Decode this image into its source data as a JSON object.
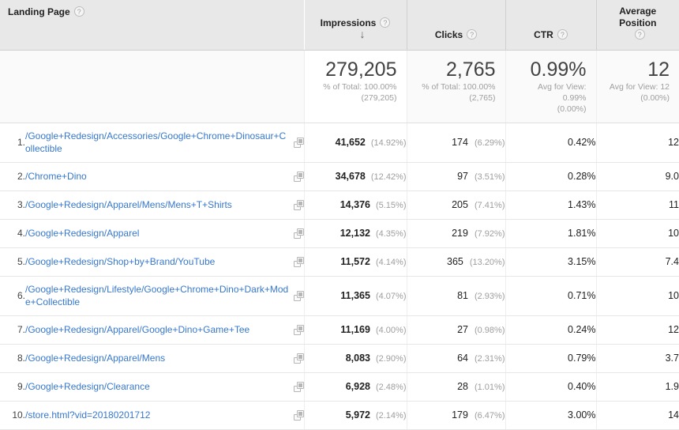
{
  "table": {
    "dimension_header": {
      "label": "Landing Page",
      "help_icon": "help-circle-icon"
    },
    "metric_headers": [
      {
        "label": "Impressions",
        "help_icon": "help-circle-icon",
        "sorted": true,
        "sort_icon": "arrow-down-icon"
      },
      {
        "label": "Clicks",
        "help_icon": "help-circle-icon",
        "sorted": false
      },
      {
        "label": "CTR",
        "help_icon": "help-circle-icon",
        "sorted": false
      },
      {
        "label": "Average Position",
        "help_icon": "help-circle-icon",
        "sorted": false
      }
    ],
    "summary": {
      "impressions": {
        "value": "279,205",
        "line1": "% of Total: 100.00%",
        "line2": "(279,205)"
      },
      "clicks": {
        "value": "2,765",
        "line1": "% of Total: 100.00%",
        "line2": "(2,765)"
      },
      "ctr": {
        "value": "0.99%",
        "line1": "Avg for View: 0.99%",
        "line2": "(0.00%)"
      },
      "avg_position": {
        "value": "12",
        "line1": "Avg for View: 12",
        "line2": "(0.00%)"
      }
    },
    "rows": [
      {
        "index": "1.",
        "page": "/Google+Redesign/Accessories/Google+Chrome+Dinosaur+Collectible",
        "link_icon": "open-in-new-icon",
        "impressions": "41,652",
        "impressions_pct": "(14.92%)",
        "clicks": "174",
        "clicks_pct": "(6.29%)",
        "ctr": "0.42%",
        "avg_position": "12",
        "tall": true
      },
      {
        "index": "2.",
        "page": "/Chrome+Dino",
        "link_icon": "open-in-new-icon",
        "impressions": "34,678",
        "impressions_pct": "(12.42%)",
        "clicks": "97",
        "clicks_pct": "(3.51%)",
        "ctr": "0.28%",
        "avg_position": "9.0",
        "tall": false
      },
      {
        "index": "3.",
        "page": "/Google+Redesign/Apparel/Mens/Mens+T+Shirts",
        "link_icon": "open-in-new-icon",
        "impressions": "14,376",
        "impressions_pct": "(5.15%)",
        "clicks": "205",
        "clicks_pct": "(7.41%)",
        "ctr": "1.43%",
        "avg_position": "11",
        "tall": false
      },
      {
        "index": "4.",
        "page": "/Google+Redesign/Apparel",
        "link_icon": "open-in-new-icon",
        "impressions": "12,132",
        "impressions_pct": "(4.35%)",
        "clicks": "219",
        "clicks_pct": "(7.92%)",
        "ctr": "1.81%",
        "avg_position": "10",
        "tall": false
      },
      {
        "index": "5.",
        "page": "/Google+Redesign/Shop+by+Brand/YouTube",
        "link_icon": "open-in-new-icon",
        "impressions": "11,572",
        "impressions_pct": "(4.14%)",
        "clicks": "365",
        "clicks_pct": "(13.20%)",
        "ctr": "3.15%",
        "avg_position": "7.4",
        "tall": false
      },
      {
        "index": "6.",
        "page": "/Google+Redesign/Lifestyle/Google+Chrome+Dino+Dark+Mode+Collectible",
        "link_icon": "open-in-new-icon",
        "impressions": "11,365",
        "impressions_pct": "(4.07%)",
        "clicks": "81",
        "clicks_pct": "(2.93%)",
        "ctr": "0.71%",
        "avg_position": "10",
        "tall": true
      },
      {
        "index": "7.",
        "page": "/Google+Redesign/Apparel/Google+Dino+Game+Tee",
        "link_icon": "open-in-new-icon",
        "impressions": "11,169",
        "impressions_pct": "(4.00%)",
        "clicks": "27",
        "clicks_pct": "(0.98%)",
        "ctr": "0.24%",
        "avg_position": "12",
        "tall": false
      },
      {
        "index": "8.",
        "page": "/Google+Redesign/Apparel/Mens",
        "link_icon": "open-in-new-icon",
        "impressions": "8,083",
        "impressions_pct": "(2.90%)",
        "clicks": "64",
        "clicks_pct": "(2.31%)",
        "ctr": "0.79%",
        "avg_position": "3.7",
        "tall": false
      },
      {
        "index": "9.",
        "page": "/Google+Redesign/Clearance",
        "link_icon": "open-in-new-icon",
        "impressions": "6,928",
        "impressions_pct": "(2.48%)",
        "clicks": "28",
        "clicks_pct": "(1.01%)",
        "ctr": "0.40%",
        "avg_position": "1.9",
        "tall": false
      },
      {
        "index": "10.",
        "page": "/store.html?vid=20180201712",
        "link_icon": "open-in-new-icon",
        "impressions": "5,972",
        "impressions_pct": "(2.14%)",
        "clicks": "179",
        "clicks_pct": "(6.47%)",
        "ctr": "3.00%",
        "avg_position": "14",
        "tall": false
      }
    ]
  },
  "colors": {
    "link": "#3778cd",
    "header_bg": "#e8e8e8",
    "row_bg": "#ffffff",
    "muted_text": "#9e9e9e"
  },
  "icons": {
    "help": "?",
    "sort_desc": "↓"
  }
}
